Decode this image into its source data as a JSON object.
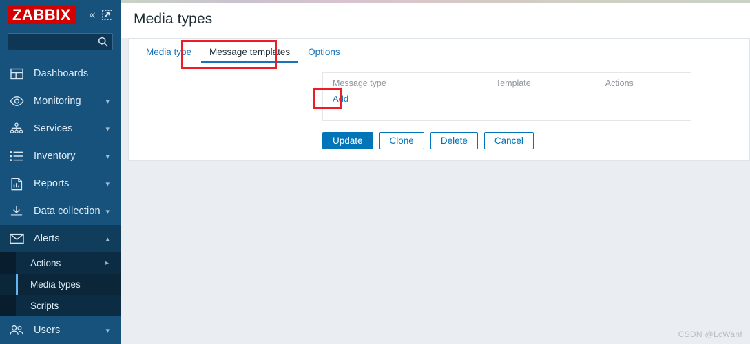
{
  "brand": {
    "logo_text": "ZABBIX",
    "logo_bg": "#d40000"
  },
  "sidebar": {
    "search": {
      "value": "",
      "placeholder": "",
      "icon": "search-icon"
    },
    "collapse_icon": "chevron-double-left-icon",
    "kiosk_icon": "kiosk-mode-icon",
    "items": [
      {
        "label": "Dashboards",
        "icon": "dashboard-grid-icon",
        "chevron": ""
      },
      {
        "label": "Monitoring",
        "icon": "eye-icon",
        "chevron": "down"
      },
      {
        "label": "Services",
        "icon": "services-tree-icon",
        "chevron": "down"
      },
      {
        "label": "Inventory",
        "icon": "list-icon",
        "chevron": "down"
      },
      {
        "label": "Reports",
        "icon": "bar-chart-document-icon",
        "chevron": "down"
      },
      {
        "label": "Data collection",
        "icon": "download-tray-icon",
        "chevron": "down"
      },
      {
        "label": "Alerts",
        "icon": "envelope-icon",
        "chevron": "up",
        "expanded": true
      },
      {
        "label": "Users",
        "icon": "users-icon",
        "chevron": "down"
      }
    ],
    "submenu": [
      {
        "label": "Actions",
        "chevron": "right",
        "selected": false
      },
      {
        "label": "Media types",
        "chevron": "",
        "selected": true
      },
      {
        "label": "Scripts",
        "chevron": "",
        "selected": false
      }
    ]
  },
  "header": {
    "title": "Media types"
  },
  "tabs": [
    {
      "label": "Media type",
      "active": false
    },
    {
      "label": "Message templates",
      "active": true
    },
    {
      "label": "Options",
      "active": false
    }
  ],
  "templates_table": {
    "columns": [
      "Message type",
      "Template",
      "Actions"
    ],
    "rows": [],
    "add_label": "Add"
  },
  "buttons": [
    {
      "label": "Update",
      "style": "primary"
    },
    {
      "label": "Clone",
      "style": "secondary"
    },
    {
      "label": "Delete",
      "style": "secondary"
    },
    {
      "label": "Cancel",
      "style": "secondary"
    }
  ],
  "watermark": {
    "text": "CSDN @LcWanf"
  },
  "annotations": {
    "tab_highlight_color": "#ee1c25",
    "add_highlight_color": "#ee1c25"
  }
}
